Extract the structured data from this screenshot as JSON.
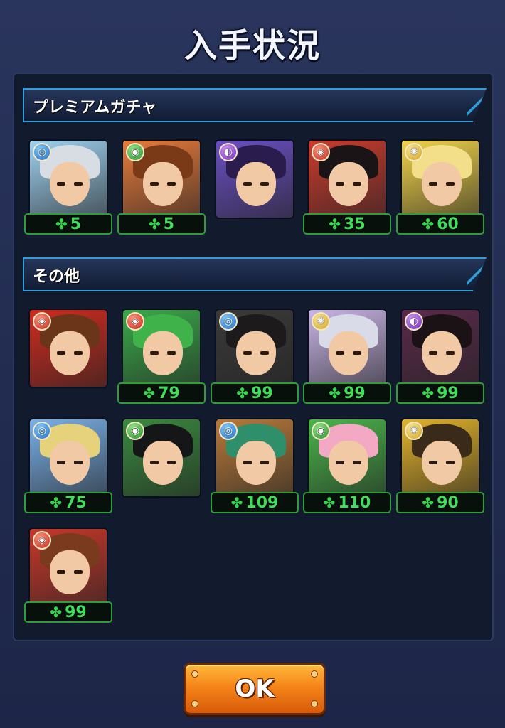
{
  "dialog": {
    "title": "入手状況",
    "ok_label": "OK"
  },
  "sections": [
    {
      "label": "プレミアムガチャ",
      "cards": [
        {
          "attribute": "water",
          "count": "5",
          "bg": "#9fd2f0",
          "hair": "#d7dde3"
        },
        {
          "attribute": "wood",
          "count": "5",
          "bg": "#e77b3c",
          "hair": "#7a3a18"
        },
        {
          "attribute": "dark",
          "count": null,
          "bg": "#6a4fc2",
          "hair": "#2a1d4d"
        },
        {
          "attribute": "fire",
          "count": "35",
          "bg": "#c93b2e",
          "hair": "#1a1416"
        },
        {
          "attribute": "light",
          "count": "60",
          "bg": "#f1d44a",
          "hair": "#f3df8a"
        }
      ]
    },
    {
      "label": "その他",
      "cards": [
        {
          "attribute": "fire",
          "count": null,
          "bg": "#cf2b20",
          "hair": "#6a3518"
        },
        {
          "attribute": "fire",
          "count": "79",
          "bg": "#3aa94a",
          "hair": "#3fb24a"
        },
        {
          "attribute": "water",
          "count": "99",
          "bg": "#3a3a3a",
          "hair": "#1c1a1a"
        },
        {
          "attribute": "light",
          "count": "99",
          "bg": "#c9b5e6",
          "hair": "#d9dbe8"
        },
        {
          "attribute": "dark",
          "count": "99",
          "bg": "#5a2a4a",
          "hair": "#1a1214"
        },
        {
          "attribute": "water",
          "count": "75",
          "bg": "#7ab0e8",
          "hair": "#e6d27a"
        },
        {
          "attribute": "wood",
          "count": null,
          "bg": "#3a8a3e",
          "hair": "#141618"
        },
        {
          "attribute": "water",
          "count": "109",
          "bg": "#b87a3a",
          "hair": "#2f8f6a"
        },
        {
          "attribute": "wood",
          "count": "110",
          "bg": "#4ab54a",
          "hair": "#f3a9c4"
        },
        {
          "attribute": "light",
          "count": "90",
          "bg": "#e2b22a",
          "hair": "#3a2a1a"
        },
        {
          "attribute": "fire",
          "count": "99",
          "bg": "#c9372a",
          "hair": "#7a3a1e"
        }
      ]
    }
  ],
  "attribute_glyphs": {
    "water": "◎",
    "wood": "◉",
    "dark": "◐",
    "fire": "◈",
    "light": "✺"
  },
  "clover_glyph": "✤"
}
